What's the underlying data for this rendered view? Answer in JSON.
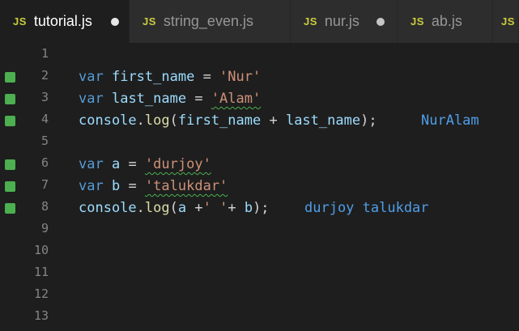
{
  "tabs": [
    {
      "icon": "JS",
      "label": "tutorial.js",
      "active": true,
      "dirty": true
    },
    {
      "icon": "JS",
      "label": "string_even.js",
      "active": false,
      "dirty": false
    },
    {
      "icon": "JS",
      "label": "nur.js",
      "active": false,
      "dirty": true
    },
    {
      "icon": "JS",
      "label": "ab.js",
      "active": false,
      "dirty": false
    },
    {
      "icon": "JS",
      "label": "",
      "active": false,
      "dirty": false
    }
  ],
  "line_numbers": [
    "1",
    "2",
    "3",
    "4",
    "5",
    "6",
    "7",
    "8",
    "9",
    "10",
    "11",
    "12",
    "13"
  ],
  "code": {
    "l2": {
      "kw": "var",
      "name": "first_name",
      "eq": " = ",
      "str": "'Nur'"
    },
    "l3": {
      "kw": "var",
      "name": "last_name",
      "eq": " = ",
      "str": "'Alam'"
    },
    "l4": {
      "obj": "console",
      "dot": ".",
      "fn": "log",
      "args_open": "(",
      "a1": "first_name",
      "plus": " + ",
      "a2": "last_name",
      "args_close": ");",
      "output": "NurAlam"
    },
    "l6": {
      "kw": "var",
      "name": "a",
      "eq": " = ",
      "str": "'durjoy'"
    },
    "l7": {
      "kw": "var",
      "name": "b",
      "eq": " = ",
      "str": "'talukdar'"
    },
    "l8": {
      "obj": "console",
      "dot": ".",
      "fn": "log",
      "args_open": "(",
      "a1": "a",
      "plus": " +",
      "str": "' '",
      "plus2": "+ ",
      "a2": "b",
      "args_close": ");",
      "output": "durjoy talukdar"
    }
  },
  "colors": {
    "gutter_marker": "#4caf50",
    "keyword": "#569cd6",
    "string": "#ce9178",
    "variable": "#9cdcfe",
    "function": "#dcdcaa",
    "output": "#4f9ee8",
    "js_icon": "#cbcb41"
  }
}
